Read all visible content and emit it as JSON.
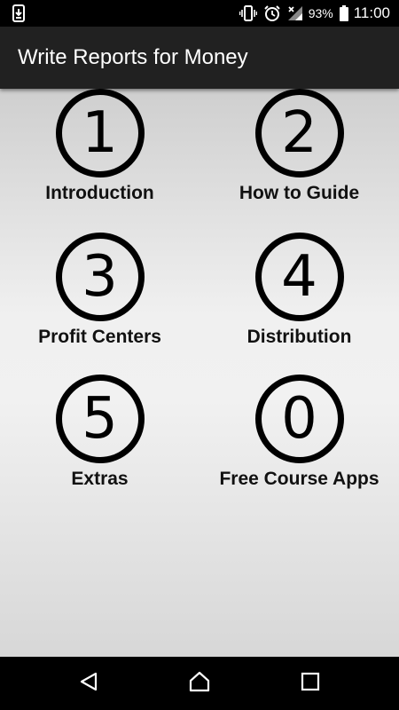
{
  "status_bar": {
    "left_icon": "download-notification-icon",
    "icons": [
      "vibrate-icon",
      "alarm-icon",
      "signal-icon",
      "battery-icon"
    ],
    "battery_percent": "93%",
    "time": "11:00"
  },
  "toolbar": {
    "title": "Write Reports for Money",
    "background": "#212121"
  },
  "menu": {
    "items": [
      {
        "number": "1",
        "label": "Introduction"
      },
      {
        "number": "2",
        "label": "How to Guide"
      },
      {
        "number": "3",
        "label": "Profit Centers"
      },
      {
        "number": "4",
        "label": "Distribution"
      },
      {
        "number": "5",
        "label": "Extras"
      },
      {
        "number": "0",
        "label": "Free Course Apps"
      }
    ]
  },
  "nav_bar": {
    "buttons": [
      "back-icon",
      "home-icon",
      "recents-icon"
    ]
  }
}
